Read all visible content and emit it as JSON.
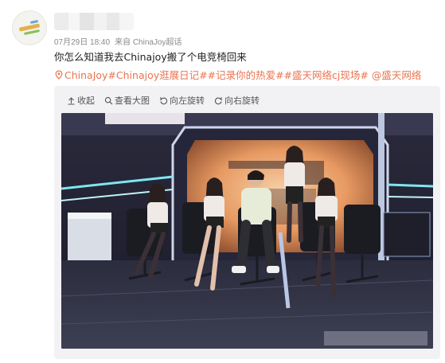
{
  "post": {
    "meta_date": "07月29日 18:40",
    "meta_source": "来自 ChinaJoy超话",
    "text": "你怎么知道我去Chinajoy搬了个电竞椅回来",
    "tags": "ChinaJoy#Chinajoy逛展日记##记录你的热爱##盛天网络cj现场# @盛天网络"
  },
  "toolbar": {
    "collapse_label": "收起",
    "view_large_label": "查看大图",
    "rotate_left_label": "向左旋转",
    "rotate_right_label": "向右旋转"
  },
  "icons": {
    "location": "location-icon",
    "collapse": "collapse-icon",
    "view_large": "magnifier-icon",
    "rotate_left": "rotate-left-icon",
    "rotate_right": "rotate-right-icon"
  },
  "colors": {
    "link_orange": "#eb7350",
    "meta_gray": "#8a8a8a",
    "media_bg": "#f2f2f5"
  }
}
